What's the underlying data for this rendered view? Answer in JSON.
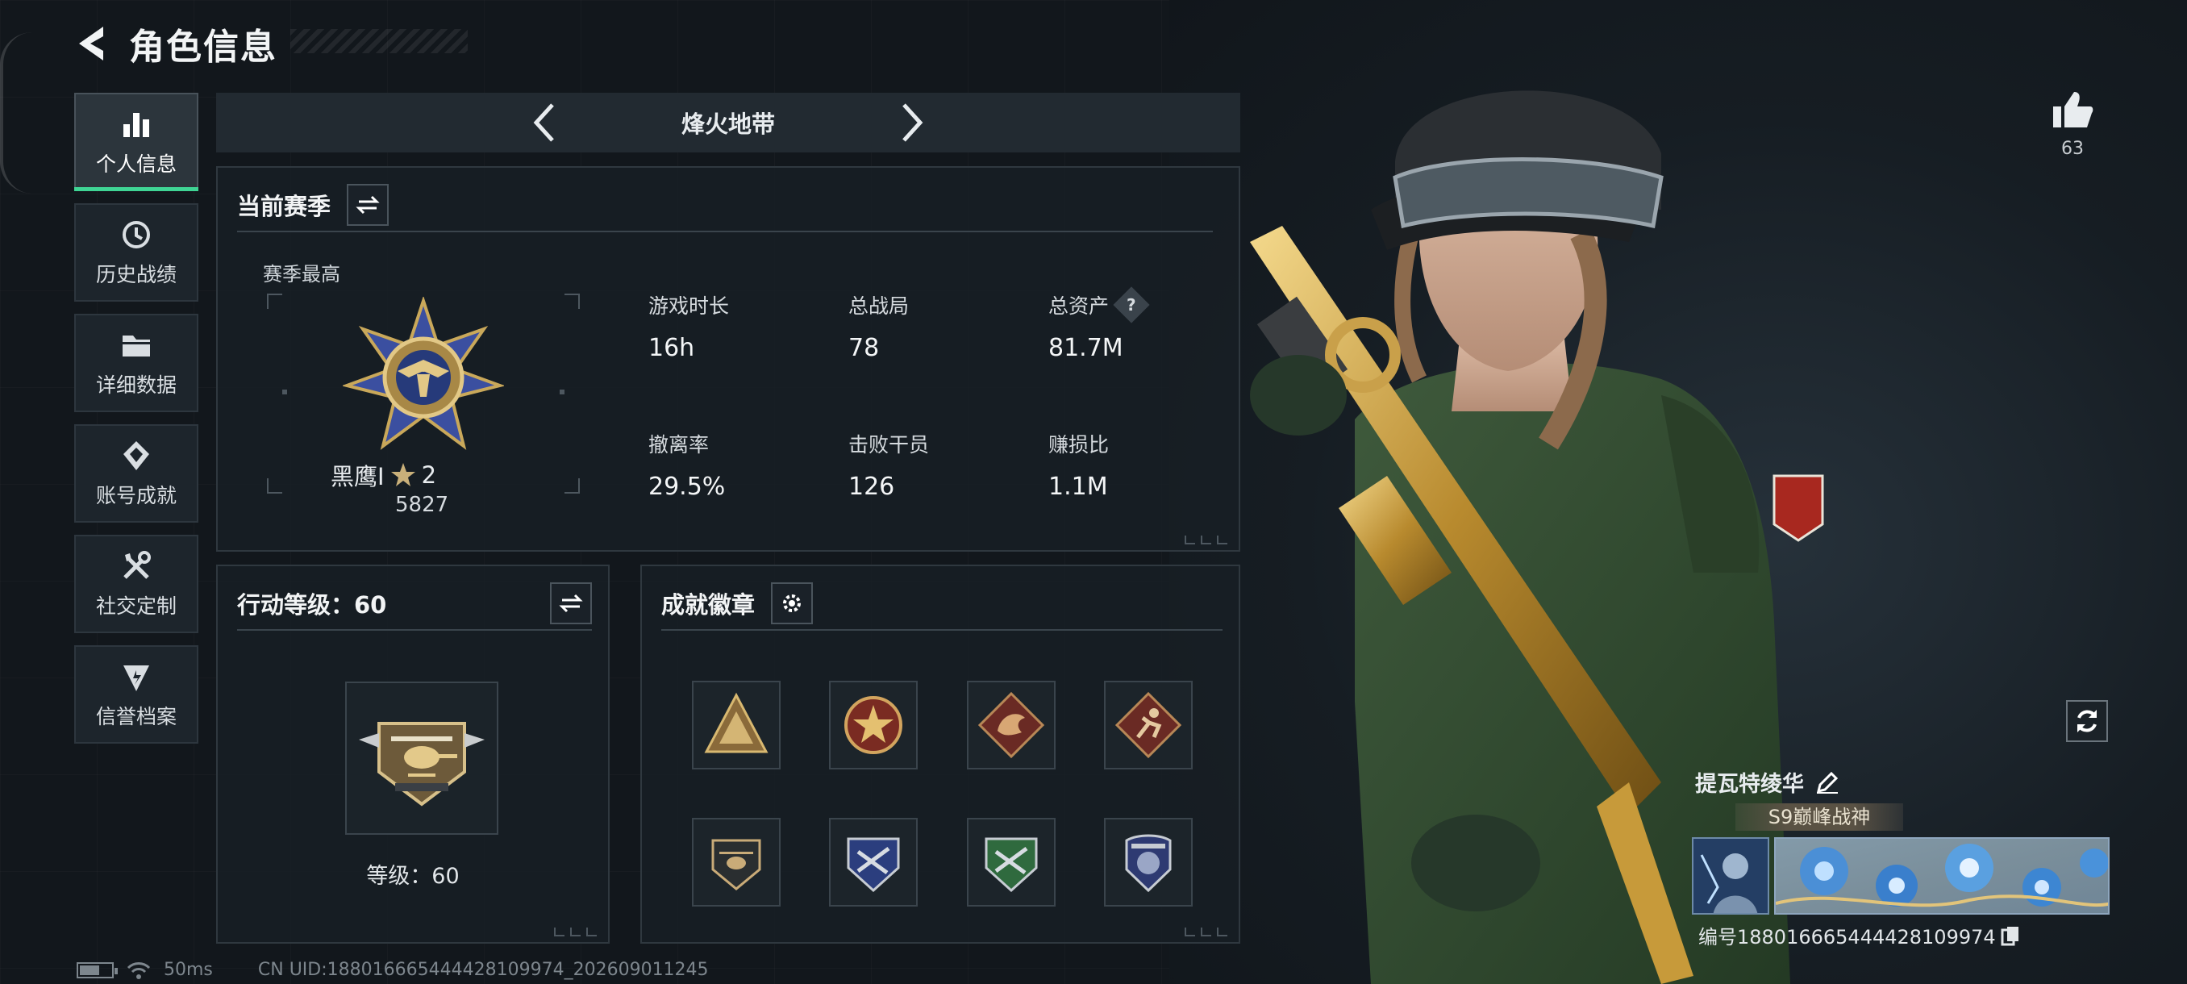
{
  "header": {
    "title": "角色信息"
  },
  "sidebar": {
    "items": [
      {
        "label": "个人信息",
        "icon": "bar-chart-icon",
        "active": true
      },
      {
        "label": "历史战绩",
        "icon": "history-icon"
      },
      {
        "label": "详细数据",
        "icon": "folder-icon"
      },
      {
        "label": "账号成就",
        "icon": "achievement-icon"
      },
      {
        "label": "社交定制",
        "icon": "tools-icon"
      },
      {
        "label": "信誉档案",
        "icon": "reputation-icon"
      }
    ]
  },
  "mode_selector": {
    "name": "烽火地带"
  },
  "current_season": {
    "title": "当前赛季",
    "best_caption": "赛季最高",
    "rank_name": "黑鹰I",
    "rank_stars": "2",
    "rank_score": "5827",
    "stats": [
      {
        "label": "游戏时长",
        "value": "16h"
      },
      {
        "label": "总战局",
        "value": "78"
      },
      {
        "label": "总资产",
        "value": "81.7M",
        "help": "?"
      },
      {
        "label": "撤离率",
        "value": "29.5%"
      },
      {
        "label": "击败干员",
        "value": "126"
      },
      {
        "label": "赚损比",
        "value": "1.1M"
      }
    ]
  },
  "action_level": {
    "title": "行动等级：60",
    "level_text": "等级：60"
  },
  "achievements": {
    "title": "成就徽章",
    "badges": [
      "mountain-badge-icon",
      "red-star-badge-icon",
      "dragon-badge-icon",
      "runner-badge-icon",
      "helicopter-badge-icon",
      "blue-shield-badge-icon",
      "green-shield-badge-icon",
      "police-badge-icon"
    ]
  },
  "social": {
    "likes": "63"
  },
  "profile": {
    "name": "提瓦特绫华",
    "title": "S9巅峰战神",
    "id_line": "编号1880166654444281099​74"
  },
  "statusbar": {
    "ping": "50ms",
    "uid": "CN UID:1880166654444281099​74_202609011245"
  },
  "colors": {
    "accent": "#3fd494",
    "panel": "#181f25",
    "background": "#12171c"
  }
}
